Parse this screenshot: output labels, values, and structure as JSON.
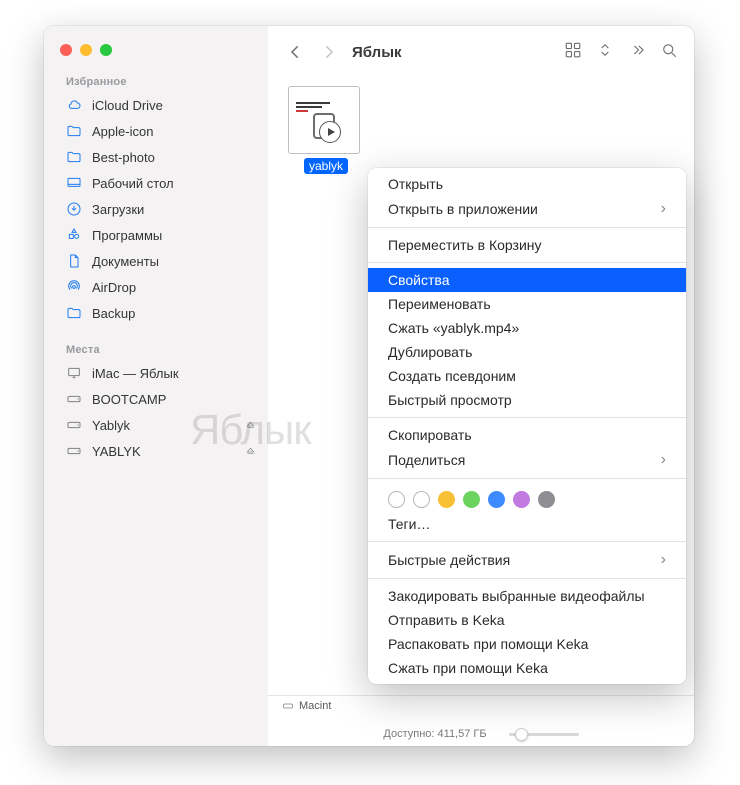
{
  "sidebar": {
    "favorites_title": "Избранное",
    "items": [
      {
        "label": "iCloud Drive",
        "icon": "cloud"
      },
      {
        "label": "Apple-icon",
        "icon": "folder"
      },
      {
        "label": "Best-photo",
        "icon": "folder"
      },
      {
        "label": "Рабочий стол",
        "icon": "desktop"
      },
      {
        "label": "Загрузки",
        "icon": "download"
      },
      {
        "label": "Программы",
        "icon": "apps"
      },
      {
        "label": "Документы",
        "icon": "doc"
      },
      {
        "label": "AirDrop",
        "icon": "airdrop"
      },
      {
        "label": "Backup",
        "icon": "folder"
      }
    ],
    "locations_title": "Места",
    "locations": [
      {
        "label": "iMac — Яблык",
        "icon": "imac",
        "eject": false
      },
      {
        "label": "BOOTCAMP",
        "icon": "disk",
        "eject": false
      },
      {
        "label": "Yablyk",
        "icon": "disk",
        "eject": true
      },
      {
        "label": "YABLYK",
        "icon": "disk",
        "eject": true
      }
    ]
  },
  "toolbar": {
    "title": "Яблык"
  },
  "file": {
    "label": "yablyk"
  },
  "context_menu": {
    "open": "Открыть",
    "open_with": "Открыть в приложении",
    "move_to_trash": "Переместить в Корзину",
    "get_info": "Свойства",
    "rename": "Переименовать",
    "compress": "Сжать «yablyk.mp4»",
    "duplicate": "Дублировать",
    "make_alias": "Создать псевдоним",
    "quick_look": "Быстрый просмотр",
    "copy": "Скопировать",
    "share": "Поделиться",
    "tags": "Теги…",
    "quick_actions": "Быстрые действия",
    "encode_video": "Закодировать выбранные видеофайлы",
    "send_keka": "Отправить в Keka",
    "unpack_keka": "Распаковать при помощи Keka",
    "compress_keka": "Сжать при помощи Keka",
    "tag_colors": [
      "transparent",
      "transparent",
      "#f8c035",
      "#6bd45f",
      "#3e8bff",
      "#c17adf",
      "#8e8e93"
    ]
  },
  "pathbar": {
    "item": "Macint"
  },
  "statusbar": {
    "text": "Доступно: 411,57 ГБ"
  },
  "watermark": "Яблык"
}
